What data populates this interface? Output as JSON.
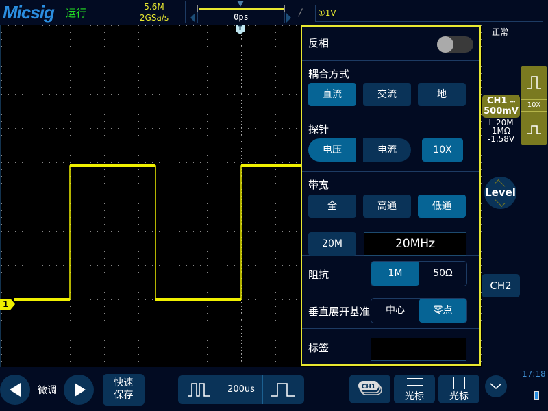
{
  "header": {
    "brand": "Micsig",
    "run_status": "运行",
    "memory_depth": "5.6M",
    "sample_rate": "2GSa/s",
    "trigger_delay": "0ps",
    "trigger_edge_icon": "rising-edge-icon",
    "trigger_info": "①1V",
    "trigger_mode": "正常"
  },
  "screen": {
    "trigger_marker": "T",
    "ch1_marker": "1",
    "grid_divisions": {
      "horizontal": 14,
      "vertical": 10
    },
    "waveform": {
      "channel": "CH1",
      "color": "#f0f000",
      "shape": "square",
      "levels_div": {
        "high": 0.9,
        "low": -3.0
      },
      "edges_div_from_left": [
        {
          "type": "rising",
          "at": 2.0
        },
        {
          "type": "falling",
          "at": 4.5
        },
        {
          "type": "rising",
          "at": 7.0
        }
      ]
    }
  },
  "panel": {
    "invert": {
      "label": "反相",
      "on": false
    },
    "coupling": {
      "label": "耦合方式",
      "options": [
        {
          "label": "直流",
          "selected": true
        },
        {
          "label": "交流",
          "selected": false
        },
        {
          "label": "地",
          "selected": false
        }
      ]
    },
    "probe": {
      "label": "探针",
      "options": [
        {
          "label": "电压",
          "selected": true
        },
        {
          "label": "电流",
          "selected": false
        }
      ],
      "ratio": "10X"
    },
    "bandwidth": {
      "label": "带宽",
      "options": [
        {
          "label": "全",
          "selected": false
        },
        {
          "label": "高通",
          "selected": false
        },
        {
          "label": "低通",
          "selected": true
        }
      ],
      "preset": "20M",
      "value": "20MHz"
    },
    "impedance": {
      "label": "阻抗",
      "options": [
        {
          "label": "1M",
          "selected": true
        },
        {
          "label": "50Ω",
          "selected": false
        }
      ]
    },
    "vertical_ref": {
      "label": "垂直展开基准",
      "options": [
        {
          "label": "中心",
          "selected": false
        },
        {
          "label": "零点",
          "selected": true
        }
      ]
    },
    "tag": {
      "label": "标签",
      "value": ""
    }
  },
  "right": {
    "ch1": {
      "name": "CH1",
      "coupling_icon": "dc-coupling-icon",
      "scale": "500mV",
      "bw": "L 20M",
      "impedance": "1MΩ",
      "offset": "-1.58V"
    },
    "probe_ratio": "10X",
    "level_label": "Level",
    "ch2_label": "CH2"
  },
  "bottom": {
    "fine_label": "微调",
    "quick_save": [
      "快速",
      "保存"
    ],
    "timebase": "200us",
    "ch1_tag": "CH1",
    "cursor_h_label": "光标",
    "cursor_v_label": "光标",
    "clock": "17:18"
  },
  "colors": {
    "ch1": "#f0f000",
    "accent": "#066495",
    "button": "#0a3358",
    "background": "#020b22"
  }
}
